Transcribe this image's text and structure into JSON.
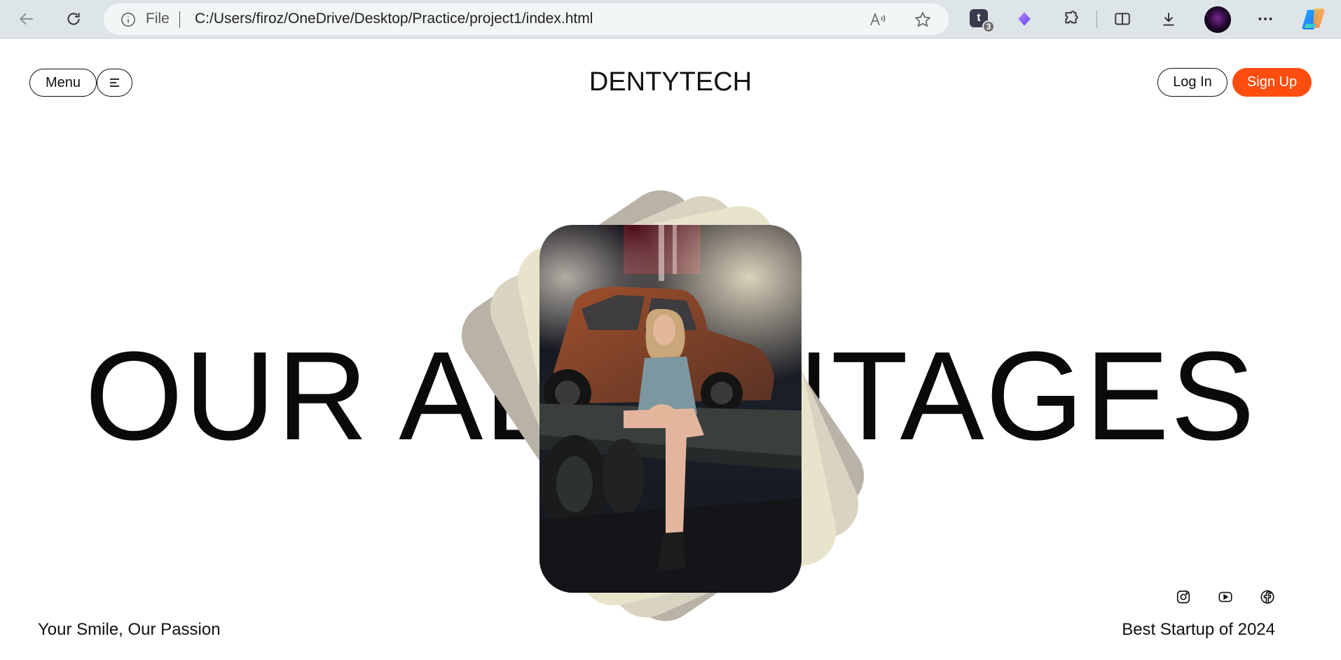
{
  "browser": {
    "file_label": "File",
    "url": "C:/Users/firoz/OneDrive/Desktop/Practice/project1/index.html",
    "tab_count": "3",
    "tab_icon_letter": "t",
    "icons": [
      "back-icon",
      "refresh-icon",
      "info-icon",
      "read-aloud-icon",
      "favorite-star-icon",
      "tab-actions-icon",
      "extension-gem-icon",
      "extensions-icon",
      "split-screen-icon",
      "downloads-icon",
      "profile-avatar",
      "more-icon",
      "copilot-icon"
    ]
  },
  "header": {
    "menu_label": "Menu",
    "brand": "DENTYTECH",
    "login_label": "Log In",
    "signup_label": "Sign Up"
  },
  "hero": {
    "title": "OUR ADVANTAGES"
  },
  "footer": {
    "tagline": "Your Smile, Our Passion",
    "award": "Best Startup of 2024",
    "social_icons": [
      "instagram-icon",
      "youtube-icon",
      "facebook-icon"
    ]
  },
  "colors": {
    "accent": "#ff4d0f",
    "text": "#111111",
    "chrome": "#dde5e8"
  }
}
